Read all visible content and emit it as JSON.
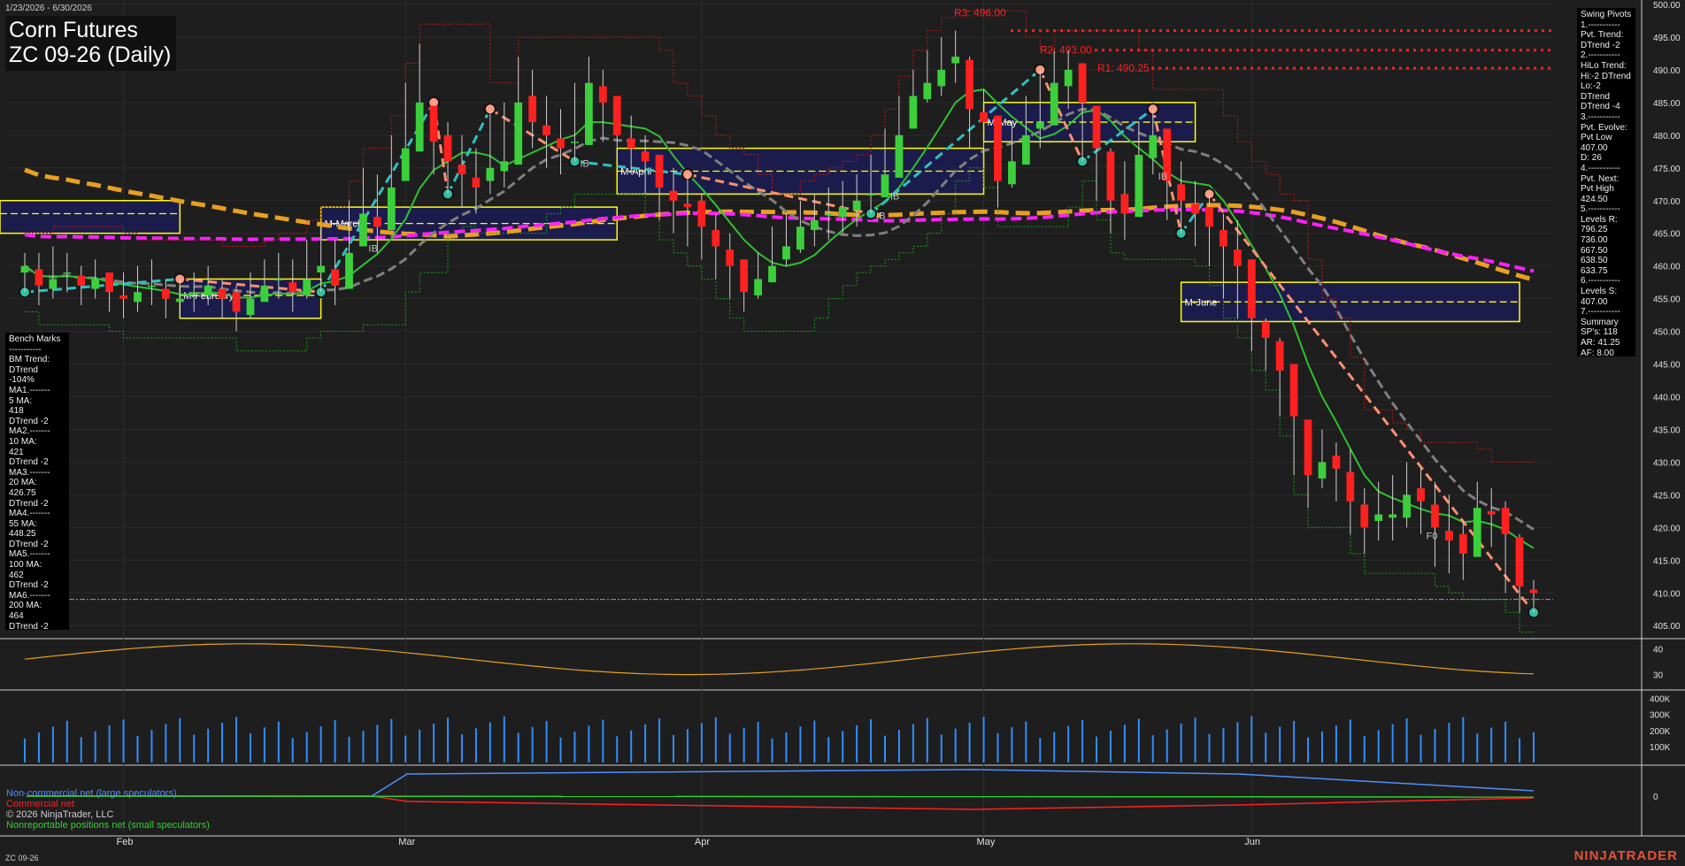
{
  "header": {
    "date_range": "1/23/2026 - 6/30/2026",
    "title_line1": "Corn Futures",
    "title_line2": "ZC 09-26 (Daily)"
  },
  "benchmarks_panel": [
    "Bench Marks",
    "-----------",
    "BM Trend:",
    "DTrend -104%",
    "MA1.-------",
    "5 MA:",
    "418",
    "DTrend -2",
    "MA2.-------",
    "10 MA:",
    "421",
    "DTrend -2",
    "MA3.-------",
    "20 MA:",
    "426.75",
    "DTrend -2",
    "MA4.-------",
    "55 MA:",
    "448.25",
    "DTrend -2",
    "MA5.-------",
    "100 MA:",
    "462",
    "DTrend -2",
    "MA6.-------",
    "200 MA:",
    "464",
    "DTrend -2"
  ],
  "swing_pivots_panel": [
    "Swing Pivots",
    "1.-----------",
    "Pvt. Trend:",
    "DTrend -2",
    "2.-----------",
    "HiLo Trend:",
    "Hi:-2 DTrend",
    "Lo:-2 DTrend",
    "DTrend -4",
    "3.-----------",
    "Pvt. Evolve:",
    "Pvt Low",
    "407.00",
    "D: 26",
    "4.-----------",
    "Pvt. Next:",
    "Pvt High",
    "424.50",
    "5.-----------",
    "Levels R:",
    "796.25",
    "736.00",
    "667.50",
    "638.50",
    "633.75",
    "6.-----------",
    "Levels S:",
    "407.00",
    "7.-----------",
    "Summary",
    "SP's: 118",
    "AR: 41.25",
    "AF: 8.00"
  ],
  "legend": {
    "noncommercial": "Non-commercial net (large speculators)",
    "commercial": "Commercial net",
    "copyright": "© 2026 NinjaTrader, LLC",
    "nonreportable": "Nonreportable positions net (small speculators)"
  },
  "footer": {
    "symbol": "ZC 09-26",
    "brand": "NINJATRADER"
  },
  "colors": {
    "background": "#1e1e1e",
    "up_candle": "#3ccf3c",
    "down_candle": "#ff2020",
    "ma_orange": "#e8a020",
    "ma_magenta": "#ff20ff",
    "ma_gray": "#808080",
    "ma_green": "#30c030",
    "resistance": "#ff2020",
    "box_border": "#ffff00",
    "box_fill": "#1c1c5c",
    "swing_up": "#30c0c0",
    "swing_down": "#ff9070",
    "volume": "#2f8fff"
  },
  "chart_data": {
    "type": "candlestick",
    "title": "ZC 09-26 (Daily)",
    "x_range": [
      "2026-01-23",
      "2026-06-30"
    ],
    "ylim": [
      403,
      500
    ],
    "y_ticks": [
      500,
      495,
      490,
      485,
      480,
      475,
      470,
      465,
      460,
      455,
      450,
      445,
      440,
      435,
      430,
      425,
      420,
      415,
      410,
      405
    ],
    "x_month_labels": [
      "Feb",
      "Mar",
      "Apr",
      "May",
      "Jun"
    ],
    "closes": [
      460,
      457,
      458,
      459,
      457,
      458,
      456,
      455,
      456,
      457,
      455,
      455,
      456,
      457,
      455,
      453,
      455,
      457,
      458,
      456,
      458,
      460,
      457,
      462,
      468,
      466,
      472,
      478,
      485,
      479,
      476,
      474,
      472,
      475,
      476,
      485,
      482,
      480,
      478,
      479,
      488,
      485,
      480,
      478,
      476,
      472,
      470,
      469,
      466,
      463,
      460,
      456,
      458,
      460,
      463,
      466,
      467,
      468,
      469,
      470,
      471,
      474,
      480,
      486,
      488,
      490,
      492,
      484,
      482,
      473,
      476,
      480,
      482,
      488,
      490,
      485,
      478,
      470,
      468,
      477,
      480,
      473,
      470,
      468,
      466,
      463,
      460,
      452,
      449,
      444,
      437,
      428,
      430,
      429,
      424,
      420,
      422,
      422,
      425,
      424,
      420,
      418,
      416,
      423,
      422,
      419,
      411,
      410
    ],
    "highs": [
      462,
      462,
      463,
      462,
      460,
      461,
      459,
      459,
      460,
      461,
      458,
      458,
      459,
      460,
      458,
      457,
      459,
      461,
      462,
      461,
      464,
      466,
      464,
      470,
      475,
      474,
      480,
      488,
      494,
      485,
      482,
      480,
      478,
      484,
      485,
      492,
      490,
      486,
      484,
      488,
      492,
      490,
      485,
      483,
      480,
      477,
      475,
      474,
      471,
      468,
      465,
      461,
      462,
      466,
      468,
      470,
      471,
      472,
      473,
      474,
      477,
      481,
      486,
      490,
      493,
      495,
      496,
      492,
      487,
      480,
      482,
      486,
      490,
      493,
      493,
      490,
      484,
      478,
      476,
      482,
      484,
      480,
      476,
      473,
      471,
      468,
      467,
      458,
      452,
      449,
      443,
      434,
      435,
      433,
      432,
      426,
      427,
      428,
      430,
      429,
      427,
      425,
      421,
      427,
      426,
      424,
      419,
      412
    ],
    "lows": [
      456,
      454,
      455,
      456,
      454,
      455,
      453,
      452,
      453,
      454,
      452,
      452,
      453,
      454,
      452,
      450,
      452,
      455,
      455,
      453,
      455,
      456,
      454,
      459,
      463,
      462,
      468,
      474,
      478,
      474,
      471,
      469,
      468,
      471,
      472,
      480,
      478,
      475,
      474,
      476,
      483,
      479,
      476,
      474,
      471,
      467,
      465,
      463,
      461,
      458,
      455,
      453,
      455,
      458,
      460,
      462,
      463,
      464,
      465,
      466,
      468,
      471,
      476,
      482,
      485,
      486,
      488,
      478,
      475,
      469,
      472,
      476,
      478,
      483,
      484,
      476,
      470,
      465,
      464,
      471,
      474,
      467,
      465,
      463,
      460,
      455,
      452,
      447,
      444,
      437,
      428,
      423,
      426,
      424,
      419,
      416,
      418,
      418,
      420,
      419,
      414,
      413,
      412,
      418,
      417,
      410,
      407,
      407
    ],
    "moving_averages": [
      {
        "name": "MA1 5",
        "value": 418
      },
      {
        "name": "MA2 10",
        "value": 421
      },
      {
        "name": "MA3 20",
        "value": 426.75
      },
      {
        "name": "MA4 55",
        "value": 448.25
      },
      {
        "name": "MA5 100",
        "value": 462
      },
      {
        "name": "MA6 200",
        "value": 464
      }
    ],
    "resistance_labels": [
      {
        "label": "R3: 496.00",
        "price": 496.0
      },
      {
        "label": "R2: 493.00",
        "price": 493.0
      },
      {
        "label": "R1: 490.25",
        "price": 490.25
      }
    ],
    "support_level": 409,
    "monthly_boxes": [
      {
        "label": "M-February",
        "high": 458,
        "mid": 455.5,
        "low": 452
      },
      {
        "label": "M-March",
        "high": 469,
        "mid": 466.5,
        "low": 464
      },
      {
        "label": "M-April",
        "high": 478,
        "mid": 474.5,
        "low": 471
      },
      {
        "label": "M-May",
        "high": 485,
        "mid": 482,
        "low": 479
      },
      {
        "label": "M-June",
        "high": 457.5,
        "mid": 454.5,
        "low": 451.5
      }
    ],
    "swing_markers": [
      "IB",
      "IB",
      "IB",
      "IB",
      "IB",
      "F0"
    ],
    "indicator1": {
      "y_ticks": [
        40,
        30
      ]
    },
    "volume": {
      "y_ticks": [
        "400K",
        "300K",
        "200K",
        "100K"
      ]
    },
    "cot": {
      "y_ticks": [
        "0"
      ]
    }
  }
}
